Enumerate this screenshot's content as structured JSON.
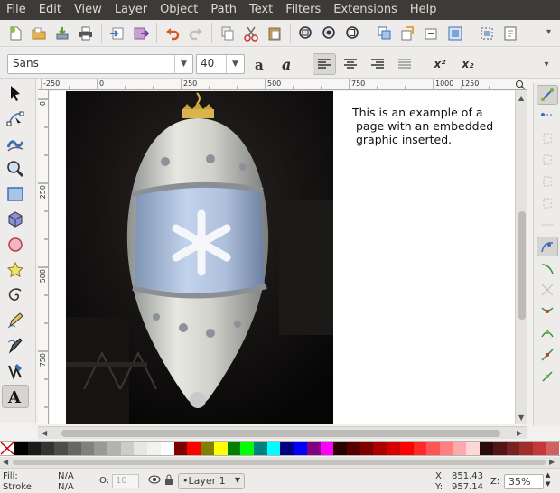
{
  "menubar": {
    "items": [
      "File",
      "Edit",
      "View",
      "Layer",
      "Object",
      "Path",
      "Text",
      "Filters",
      "Extensions",
      "Help"
    ]
  },
  "text_toolbar": {
    "font_family": "Sans",
    "font_size": "40",
    "superscript_label": "x²",
    "subscript_label": "x₂"
  },
  "ruler": {
    "top_ticks": [
      "-250",
      "0",
      "250",
      "500",
      "750",
      "1000",
      "1250"
    ],
    "left_ticks": [
      "0",
      "250",
      "500",
      "750",
      "1000"
    ]
  },
  "canvas": {
    "caption_lines": [
      "This is an example of a",
      " page with an embedded",
      " graphic inserted."
    ]
  },
  "palette": {
    "colors": [
      "#000000",
      "#1a1a1a",
      "#333333",
      "#4d4d4d",
      "#666666",
      "#808080",
      "#999999",
      "#b3b3b3",
      "#cccccc",
      "#e6e6e6",
      "#f2f2f2",
      "#ffffff",
      "#800000",
      "#ff0000",
      "#808000",
      "#ffff00",
      "#008000",
      "#00ff00",
      "#008080",
      "#00ffff",
      "#000080",
      "#0000ff",
      "#800080",
      "#ff00ff",
      "#2b0000",
      "#550000",
      "#800000",
      "#aa0000",
      "#d40000",
      "#ff0000",
      "#ff2a2a",
      "#ff5555",
      "#ff8080",
      "#ffaaaa",
      "#ffd5d5",
      "#280b0b",
      "#501616",
      "#782121",
      "#a02c2c",
      "#c83737",
      "#d35f5f"
    ]
  },
  "status": {
    "fill_label": "Fill:",
    "fill_value": "N/A",
    "stroke_label": "Stroke:",
    "stroke_value": "N/A",
    "opacity_label": "O:",
    "opacity_value": "10",
    "layer_name": "•Layer 1",
    "x_label": "X:",
    "x_value": "851.43",
    "y_label": "Y:",
    "y_value": "957.14",
    "zoom_label": "Z:",
    "zoom_value": "35%"
  }
}
